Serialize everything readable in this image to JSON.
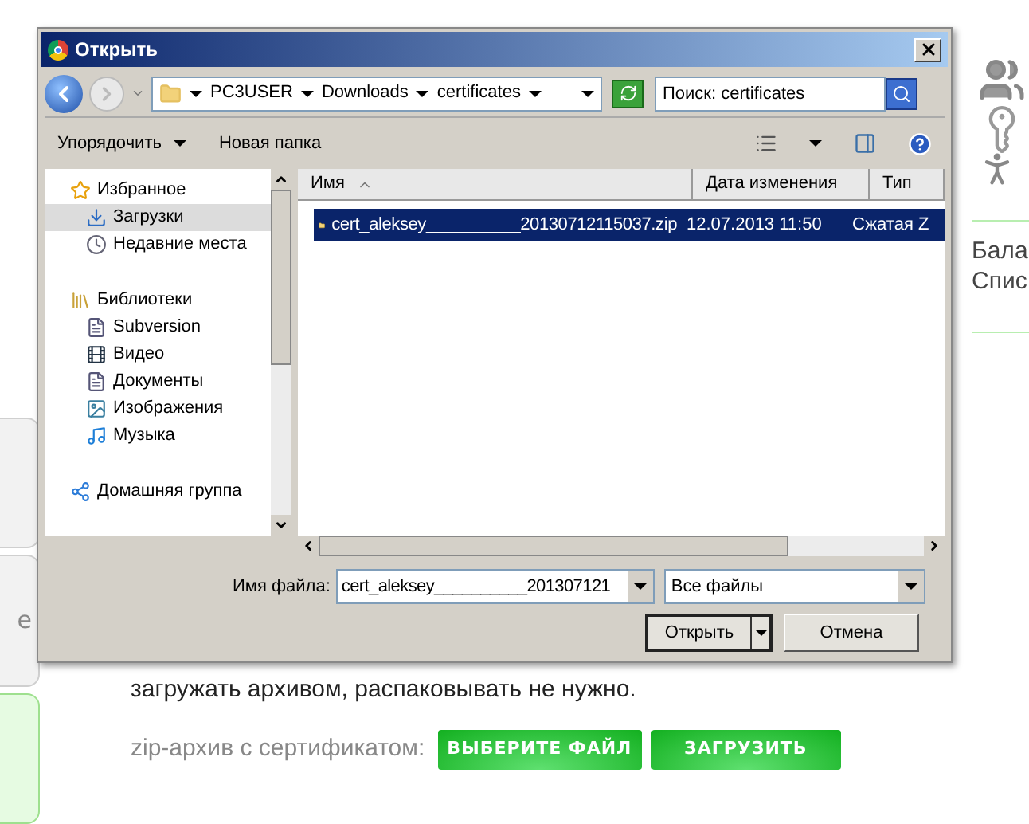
{
  "side_tabs": [
    {
      "selected": false
    },
    {
      "label": "e",
      "selected": false
    },
    {
      "selected": true
    }
  ],
  "right_panel": {
    "texts": [
      "Бала",
      "Спис"
    ]
  },
  "paragraph": "загружать архивом, распаковывать не нужно.",
  "upload": {
    "label": "zip-архив с сертификатом:",
    "buttons": [
      "ВЫБЕРИТЕ ФАЙЛ",
      "ЗАГРУЗИТЬ"
    ]
  },
  "dialog": {
    "title": "Открыть",
    "breadcrumbs": [
      "PC3USER",
      "Downloads",
      "certificates"
    ],
    "search": {
      "placeholder": "Поиск: certificates"
    },
    "toolbar": [
      {
        "label": "Упорядочить",
        "dropdown": true
      },
      {
        "label": "Новая папка",
        "dropdown": false
      }
    ],
    "nav": [
      {
        "label": "Избранное",
        "kind": "star",
        "selected": false,
        "children": [
          {
            "label": "Загрузки",
            "kind": "download",
            "selected": true
          },
          {
            "label": "Недавние места",
            "kind": "recent",
            "selected": false
          }
        ]
      },
      {
        "label": "Библиотеки",
        "kind": "library",
        "selected": false,
        "children": [
          {
            "label": "Subversion",
            "kind": "doc",
            "selected": false
          },
          {
            "label": "Видео",
            "kind": "video",
            "selected": false
          },
          {
            "label": "Документы",
            "kind": "doc",
            "selected": false
          },
          {
            "label": "Изображения",
            "kind": "image",
            "selected": false
          },
          {
            "label": "Музыка",
            "kind": "music",
            "selected": false
          }
        ]
      },
      {
        "label": "Домашняя группа",
        "kind": "network",
        "selected": false
      }
    ],
    "columns": [
      {
        "label": "Имя",
        "sorted": true
      },
      {
        "label": "Дата изменения",
        "sorted": false
      },
      {
        "label": "Тип",
        "sorted": false
      }
    ],
    "files": [
      {
        "name": "cert_aleksey__________20130712115037.zip",
        "date": "12.07.2013 11:50",
        "type": "Сжатая Z",
        "selected": true
      }
    ],
    "file_name_label": "Имя файла:",
    "file_name": "cert_aleksey__________201307121",
    "file_type": "Все файлы",
    "open_button": "Открыть",
    "cancel_button": "Отмена"
  }
}
